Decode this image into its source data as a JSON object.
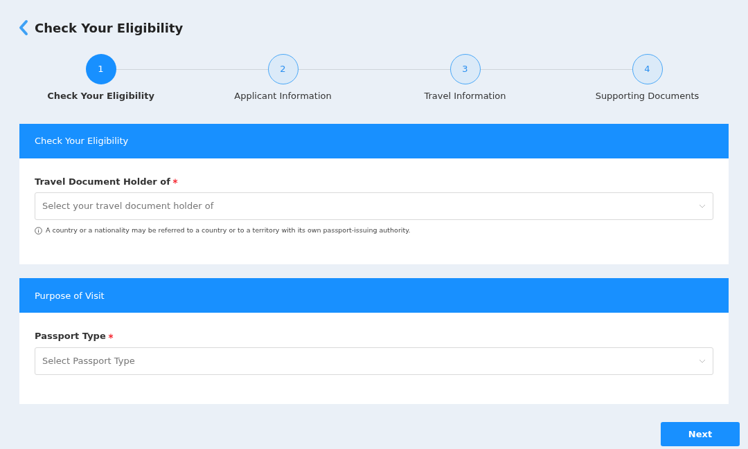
{
  "page": {
    "title": "Check Your Eligibility"
  },
  "steps": [
    {
      "number": "1",
      "label": "Check Your Eligibility",
      "selected": true
    },
    {
      "number": "2",
      "label": "Applicant Information",
      "selected": false
    },
    {
      "number": "3",
      "label": "Travel Information",
      "selected": false
    },
    {
      "number": "4",
      "label": "Supporting Documents",
      "selected": false
    }
  ],
  "sections": [
    {
      "title": "Check Your Eligibility",
      "fields": [
        {
          "label": "Travel Document Holder of",
          "required": true,
          "placeholder": "Select your travel document holder of",
          "hint": "A country or a nationality may be referred to a country or to a territory with its own passport-issuing authority."
        }
      ]
    },
    {
      "title": "Purpose of Visit",
      "fields": [
        {
          "label": "Passport Type",
          "required": true,
          "placeholder": "Select Passport Type"
        }
      ]
    }
  ],
  "next_button": "Next"
}
